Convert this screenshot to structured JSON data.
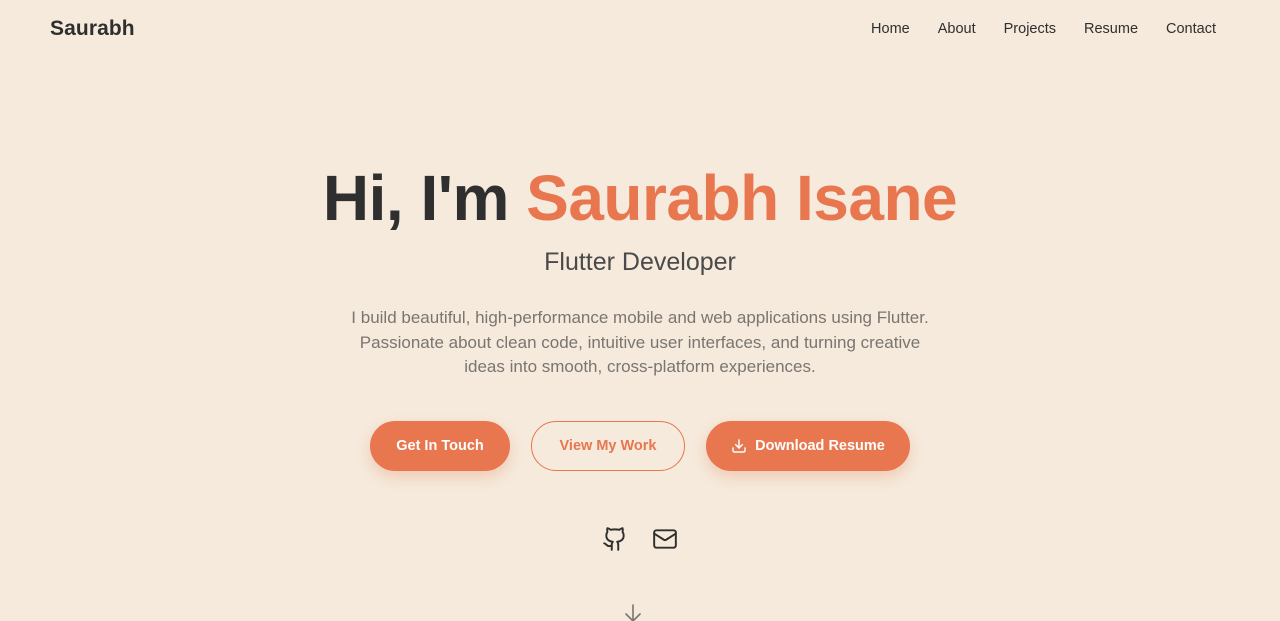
{
  "header": {
    "brand": "Saurabh",
    "nav": [
      {
        "label": "Home"
      },
      {
        "label": "About"
      },
      {
        "label": "Projects"
      },
      {
        "label": "Resume"
      },
      {
        "label": "Contact"
      }
    ]
  },
  "hero": {
    "greeting": "Hi, I'm ",
    "name": "Saurabh Isane",
    "subtitle": "Flutter Developer",
    "description": "I build beautiful, high-performance mobile and web applications using Flutter. Passionate about clean code, intuitive user interfaces, and turning creative ideas into smooth, cross-platform experiences."
  },
  "buttons": {
    "get_in_touch": "Get In Touch",
    "view_work": "View My Work",
    "download_resume": "Download Resume"
  },
  "social": {
    "icons": [
      "github-icon",
      "mail-icon"
    ]
  },
  "scroll": {
    "icon": "arrow-down-icon"
  },
  "colors": {
    "background": "#f5eadc",
    "accent": "#e8764f",
    "text": "#2f2f2f"
  }
}
